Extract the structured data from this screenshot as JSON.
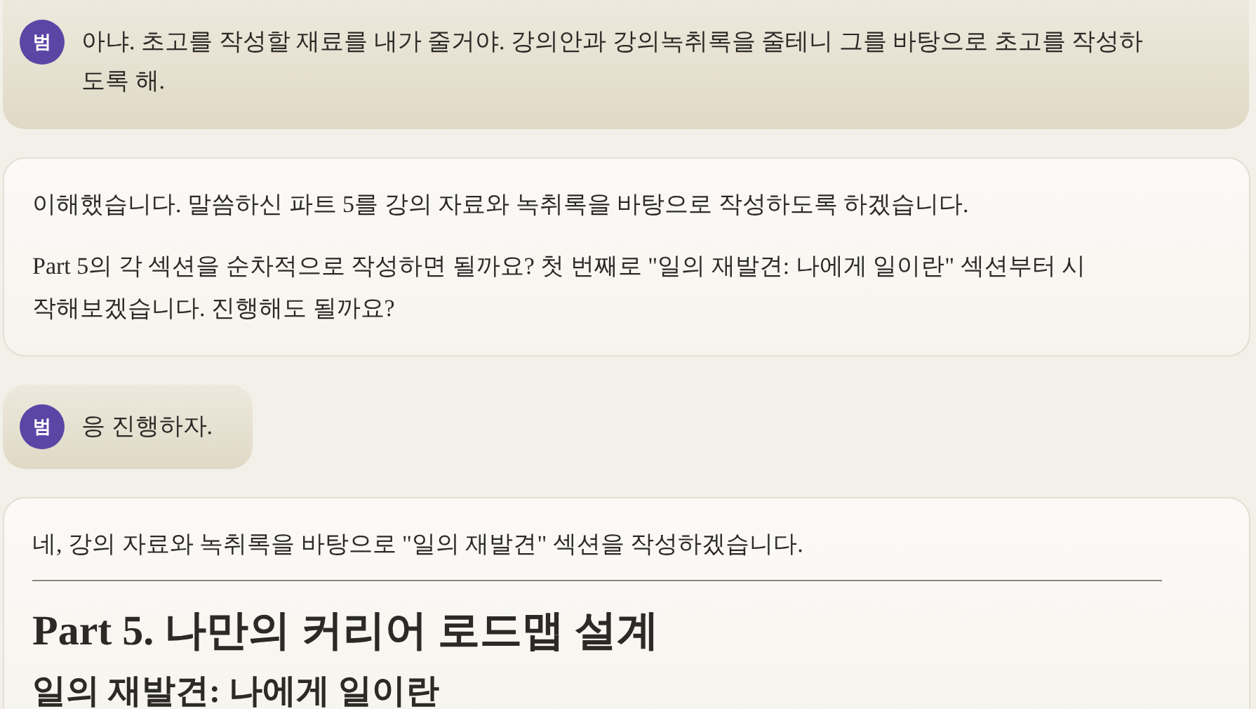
{
  "messages": [
    {
      "kind": "user",
      "avatar": "범",
      "text": "아냐. 초고를 작성할 재료를 내가 줄거야. 강의안과 강의녹취록을 줄테니 그를 바탕으로 초고를 작성하도록 해."
    },
    {
      "kind": "assistant",
      "paragraphs": [
        "이해했습니다. 말씀하신 파트 5를 강의 자료와 녹취록을 바탕으로 작성하도록 하겠습니다.",
        "Part 5의 각 섹션을 순차적으로 작성하면 될까요? 첫 번째로 \"일의 재발견: 나에게 일이란\" 섹션부터 시작해보겠습니다. 진행해도 될까요?"
      ]
    },
    {
      "kind": "user",
      "avatar": "범",
      "text": "응 진행하자."
    },
    {
      "kind": "assistant",
      "paragraphs": [
        "네, 강의 자료와 녹취록을 바탕으로 \"일의 재발견\" 섹션을 작성하겠습니다."
      ],
      "rule": true,
      "heading": "Part 5. 나만의 커리어 로드맵 설계",
      "subheading": "일의 재발견: 나에게 일이란"
    }
  ]
}
